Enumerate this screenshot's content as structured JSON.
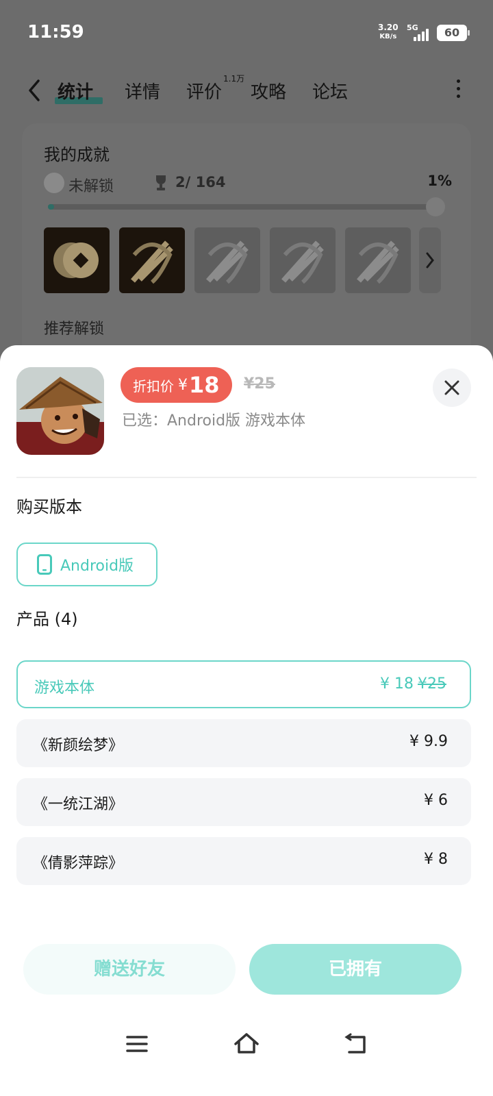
{
  "status_bar": {
    "time": "11:59",
    "net_speed_value": "3.20",
    "net_speed_unit": "KB/s",
    "network_type": "5G",
    "battery": "60"
  },
  "nav": {
    "tabs": [
      {
        "label": "统计",
        "active": true
      },
      {
        "label": "详情",
        "active": false
      },
      {
        "label": "评价",
        "active": false,
        "badge": "1.1万"
      },
      {
        "label": "攻略",
        "active": false
      },
      {
        "label": "论坛",
        "active": false
      }
    ]
  },
  "achievements": {
    "title": "我的成就",
    "locked_label": "未解锁",
    "count": "2/ 164",
    "percent": "1%",
    "progress_fraction": 0.01,
    "recommend_label": "推荐解锁"
  },
  "sheet": {
    "discount_label": "折扣价",
    "currency": "¥",
    "discount_price": "18",
    "original_price": "¥25",
    "selected_text": "已选：Android版 游戏本体",
    "version_section_title": "购买版本",
    "version_label": "Android版",
    "products_title": "产品 (4)",
    "products": [
      {
        "name": "游戏本体",
        "price": "¥ 18",
        "original": "¥25",
        "selected": true
      },
      {
        "name": "《新颜绘梦》",
        "price": "¥ 9.9",
        "original": "",
        "selected": false
      },
      {
        "name": "《一统江湖》",
        "price": "¥ 6",
        "original": "",
        "selected": false
      },
      {
        "name": "《倩影萍踪》",
        "price": "¥ 8",
        "original": "",
        "selected": false
      }
    ],
    "gift_button": "赠送好友",
    "owned_button": "已拥有"
  },
  "colors": {
    "accent": "#48c9b9",
    "accent_border": "#6bd6c9",
    "discount": "#ee6155",
    "owned_button": "#9ee6dc"
  },
  "icons": {
    "back": "back-arrow-icon",
    "more": "more-vertical-icon",
    "close": "close-icon",
    "phone": "phone-icon",
    "menu": "menu-icon",
    "home": "home-icon",
    "return": "return-icon"
  }
}
